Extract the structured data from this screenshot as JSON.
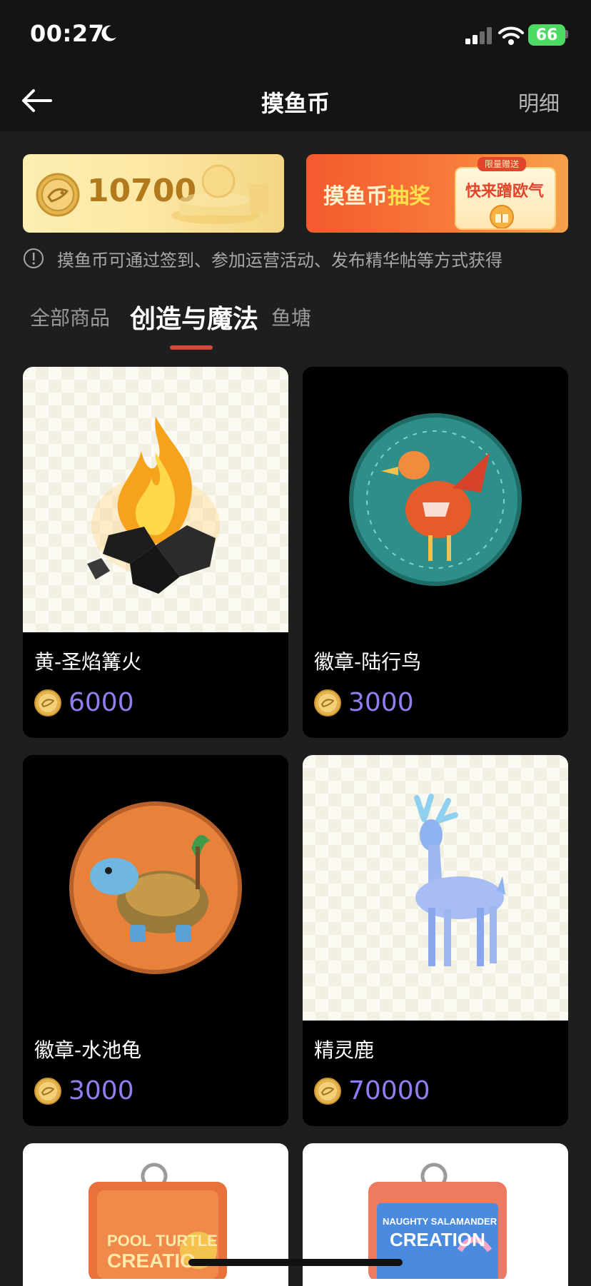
{
  "status": {
    "time": "00:27",
    "battery": "66"
  },
  "header": {
    "title": "摸鱼币",
    "detail": "明细",
    "back_icon": "arrow-left-icon"
  },
  "balance": {
    "amount": "10700"
  },
  "lottery": {
    "title_main": "摸鱼币",
    "title_highlight": "抽奖",
    "tag": "限量赠送",
    "button": "快来蹭欧气"
  },
  "tip": "摸鱼币可通过签到、参加运营活动、发布精华帖等方式获得",
  "tabs": [
    {
      "label": "全部商品"
    },
    {
      "label": "创造与魔法",
      "active": true
    },
    {
      "label": "鱼塘"
    }
  ],
  "products": [
    {
      "name": "黄-圣焰篝火",
      "price": "6000",
      "image": "bonfire"
    },
    {
      "name": "徽章-陆行鸟",
      "price": "3000",
      "image": "badge-bird"
    },
    {
      "name": "徽章-水池龟",
      "price": "3000",
      "image": "badge-turtle"
    },
    {
      "name": "精灵鹿",
      "price": "70000",
      "image": "spirit-deer"
    }
  ],
  "partial_products": [
    {
      "image": "card-holder-orange",
      "text_1": "POOL TURTLE",
      "text_2": "CREATIO"
    },
    {
      "image": "card-holder-blue",
      "text_1": "NAUGHTY SALAMANDER",
      "text_2": "CREATION"
    }
  ],
  "colors": {
    "accent": "#d5463b",
    "price": "#8d7ff0",
    "background": "#1e1e1e"
  }
}
